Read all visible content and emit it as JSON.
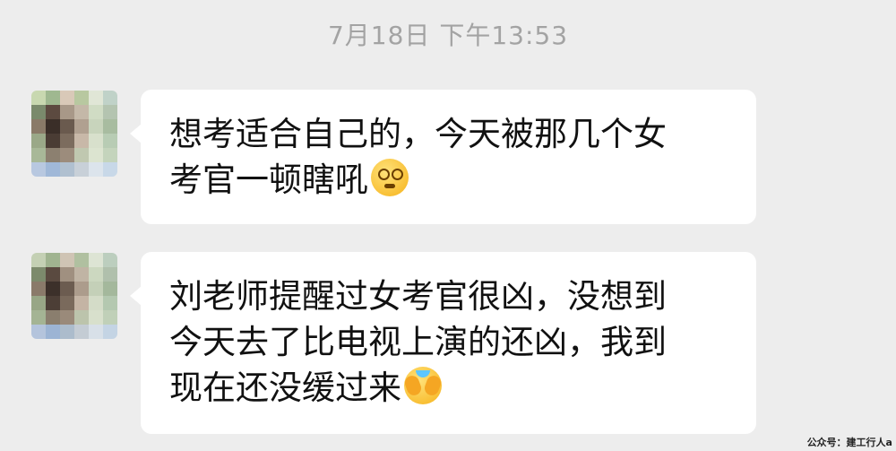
{
  "timestamp": "7月18日 下午13:53",
  "messages": [
    {
      "avatar": "pixelated-avatar",
      "lines": [
        "想考适合自己的，今天被那几个女",
        "考官一顿瞎吼"
      ],
      "emoji": "dizzy-face-emoji"
    },
    {
      "avatar": "pixelated-avatar",
      "lines": [
        "刘老师提醒过女考官很凶，没想到",
        "今天去了比电视上演的还凶，我到",
        "现在还没缓过来"
      ],
      "emoji": "crying-face-emoji"
    }
  ],
  "watermark": "公众号：建工行人a"
}
